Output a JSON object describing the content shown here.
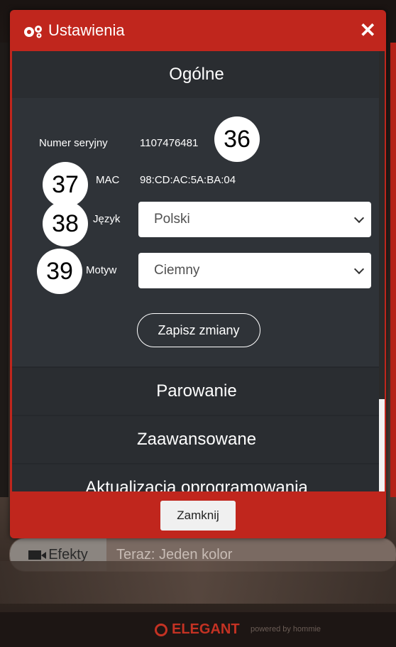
{
  "modal": {
    "title": "Ustawienia",
    "close_symbol": "✕",
    "close_button_label": "Zamknij"
  },
  "sections": {
    "general": "Ogólne",
    "pairing": "Parowanie",
    "advanced": "Zaawansowane",
    "firmware": "Aktualizacja oprogramowania"
  },
  "general": {
    "serial_label": "Numer seryjny",
    "serial_value": "1107476481",
    "mac_label": "MAC",
    "mac_value": "98:CD:AC:5A:BA:04",
    "language_label": "Język",
    "language_value": "Polski",
    "theme_label": "Motyw",
    "theme_value": "Ciemny",
    "save_label": "Zapisz zmiany"
  },
  "badges": [
    "36",
    "37",
    "38",
    "39"
  ],
  "background": {
    "effects_label": "Efekty",
    "effects_now": "Teraz: Jeden kolor",
    "brand": "ELEGANT",
    "powered": "powered by hommie"
  }
}
